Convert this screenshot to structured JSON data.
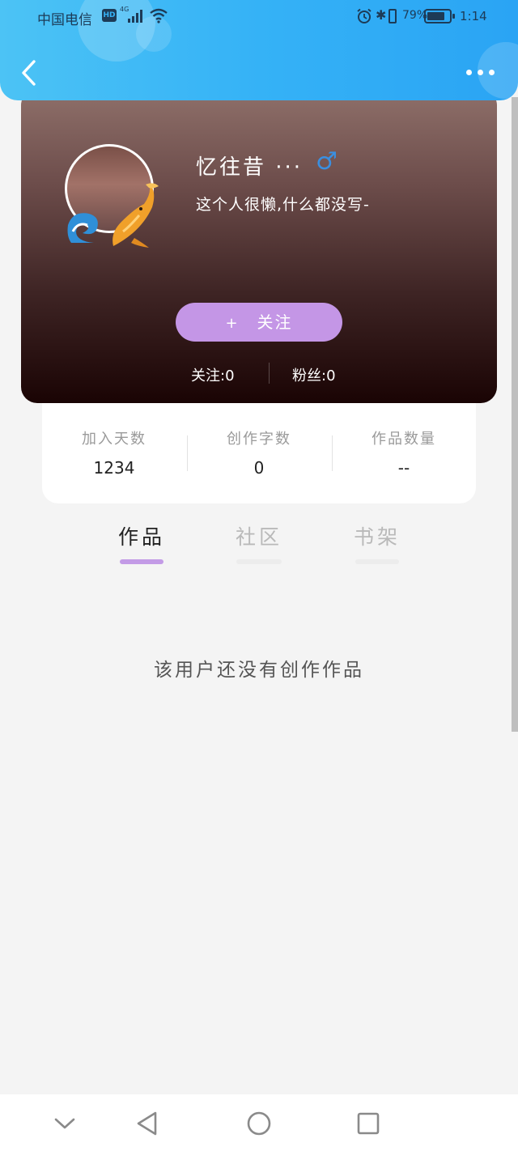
{
  "status_bar": {
    "carrier": "中国电信",
    "hd_badge": "HD",
    "network": "4G",
    "battery_text": "79%",
    "battery_level": 0.79,
    "time": "1:14"
  },
  "header": {
    "back_icon": "chevron-left-icon",
    "more_icon": "more-horizontal-icon"
  },
  "profile": {
    "nickname": "忆往昔 ···",
    "gender_symbol": "♂",
    "gender_color": "#3a8fe0",
    "bio": "这个人很懒,什么都没写-",
    "follow_button": {
      "plus": "+",
      "label": "关注"
    },
    "following": "关注:0",
    "fans": "粉丝:0"
  },
  "stats": [
    {
      "label": "加入天数",
      "value": "1234"
    },
    {
      "label": "创作字数",
      "value": "0"
    },
    {
      "label": "作品数量",
      "value": "--"
    }
  ],
  "tabs": [
    {
      "label": "作品",
      "active": true
    },
    {
      "label": "社区",
      "active": false
    },
    {
      "label": "书架",
      "active": false
    }
  ],
  "empty_message": "该用户还没有创作作品",
  "colors": {
    "header_blue": "#35b2f6",
    "accent_purple": "#c496e6",
    "tab_underline": "#c39be6",
    "background": "#f4f4f4"
  },
  "system_nav": [
    {
      "icon": "chevron-down-icon"
    },
    {
      "icon": "back-triangle-icon"
    },
    {
      "icon": "home-circle-icon"
    },
    {
      "icon": "recents-square-icon"
    }
  ]
}
